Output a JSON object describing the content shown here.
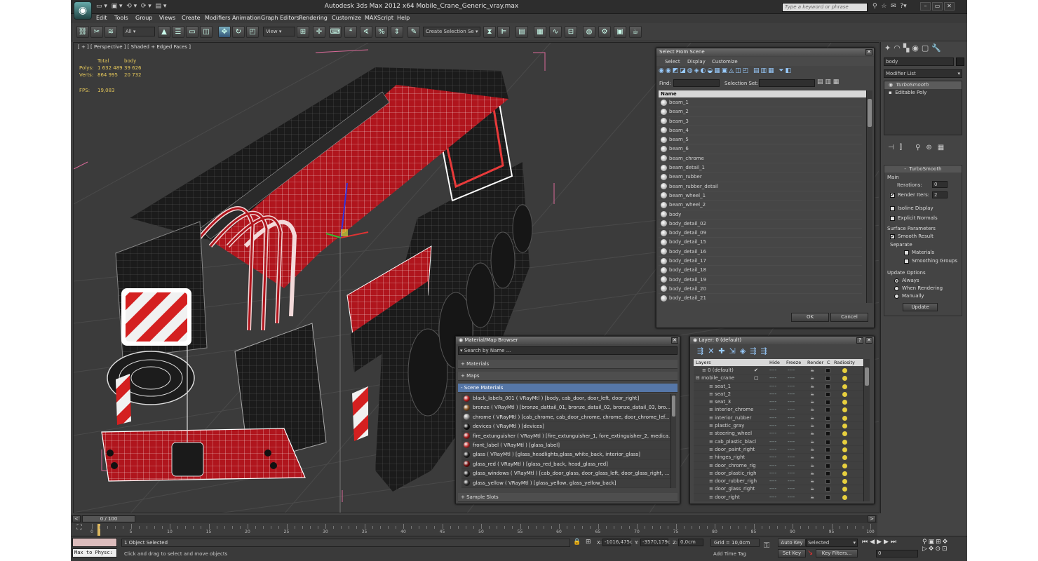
{
  "app": {
    "title": "Autodesk 3ds Max  2012 x64      Mobile_Crane_Generic_vray.max",
    "search_placeholder": "Type a keyword or phrase"
  },
  "menu": [
    "Edit",
    "Tools",
    "Group",
    "Views",
    "Create",
    "Modifiers",
    "Animation",
    "Graph Editors",
    "Rendering",
    "Customize",
    "MAXScript",
    "Help"
  ],
  "toolbar": {
    "filter": "All",
    "refcoord": "View",
    "selset": "Create Selection Se"
  },
  "viewport": {
    "label": "[ + ] [ Perspective ] [ Shaded + Edged Faces ]",
    "stats": {
      "col_total": "Total",
      "col_body": "body",
      "polys_label": "Polys:",
      "polys_total": "1 632 489",
      "polys_body": "39 626",
      "verts_label": "Verts:",
      "verts_total": "864 995",
      "verts_body": "20 732",
      "fps_label": "FPS:",
      "fps": "19,083"
    }
  },
  "select_from_scene": {
    "title": "Select From Scene",
    "tabs": [
      "Select",
      "Display",
      "Customize"
    ],
    "find_label": "Find:",
    "selset_label": "Selection Set:",
    "col_name": "Name",
    "items": [
      "beam_1",
      "beam_2",
      "beam_3",
      "beam_4",
      "beam_5",
      "beam_6",
      "beam_chrome",
      "beam_detail_1",
      "beam_rubber",
      "beam_rubber_detail",
      "beam_wheel_1",
      "beam_wheel_2",
      "body",
      "body_detail_02",
      "body_detail_09",
      "body_detail_15",
      "body_detail_16",
      "body_detail_17",
      "body_detail_18",
      "body_detail_19",
      "body_detail_20",
      "body_detail_21"
    ],
    "ok": "OK",
    "cancel": "Cancel"
  },
  "material_browser": {
    "title": "Material/Map Browser",
    "search_placeholder": "Search by Name ...",
    "cat_materials": "+ Materials",
    "cat_maps": "+ Maps",
    "cat_scene": "- Scene Materials",
    "cat_samples": "+ Sample Slots",
    "items": [
      {
        "text": "black_labels_001  ( VRayMtl )  [body, cab_door, door_left, door_right]",
        "color": "#b22"
      },
      {
        "text": "bronze  ( VRayMtl )  [bronze_dattail_01, bronze_datail_02, bronze_datail_03, bro...",
        "color": "#8a5a2a"
      },
      {
        "text": "chrome  ( VRayMtl )  [cab_chrome, cab_door_chrome, chrome, door_chrome_lef...",
        "color": "#999"
      },
      {
        "text": "devices  ( VRayMtl )  [devices]",
        "color": "#111"
      },
      {
        "text": "fire_extunguisher  ( VRayMtl )  [fire_extunguisher_1, fore_extinguisher_2, medica...",
        "color": "#a22"
      },
      {
        "text": "front_label  ( VRayMtl )  [glass_label]",
        "color": "#b33"
      },
      {
        "text": "glass  ( VRayMtl )  [glass_headlights,glass_white_back, interior_glass]",
        "color": "#222"
      },
      {
        "text": "glass_red  ( VRayMtl )  [glass_red_back, head_glass_red]",
        "color": "#711"
      },
      {
        "text": "glass_windows  ( VRayMtl )  [cab_door_glass, door_glass_left, door_glass_right, ...",
        "color": "#222"
      },
      {
        "text": "glass_yellow  ( VRayMtl )  [glass_yellow, glass_yellow_back]",
        "color": "#333"
      }
    ]
  },
  "layer_manager": {
    "title": "Layer: 0 (default)",
    "cols": [
      "Layers",
      "Hide",
      "Freeze",
      "Render",
      "C",
      "Radiosity"
    ],
    "rows": [
      {
        "name": "0 (default)",
        "indent": 1,
        "mark": "✔"
      },
      {
        "name": "mobile_crane",
        "indent": 0,
        "mark": "▢"
      },
      {
        "name": "seat_1",
        "indent": 2
      },
      {
        "name": "seat_2",
        "indent": 2
      },
      {
        "name": "seat_3",
        "indent": 2
      },
      {
        "name": "interior_chrome",
        "indent": 2
      },
      {
        "name": "interior_rubber",
        "indent": 2
      },
      {
        "name": "plastic_gray",
        "indent": 2
      },
      {
        "name": "steering_wheel",
        "indent": 2
      },
      {
        "name": "cab_plastic_blacl",
        "indent": 2
      },
      {
        "name": "door_paint_right",
        "indent": 2
      },
      {
        "name": "hinges_right",
        "indent": 2
      },
      {
        "name": "door_chrome_rig",
        "indent": 2
      },
      {
        "name": "door_plastic_righ",
        "indent": 2
      },
      {
        "name": "door_rubber_righ",
        "indent": 2
      },
      {
        "name": "door_glass_right",
        "indent": 2
      },
      {
        "name": "door_right",
        "indent": 2
      }
    ]
  },
  "command_panel": {
    "object_name": "body",
    "modifier_list": "Modifier List",
    "stack": [
      "TurboSmooth",
      "Editable Poly"
    ],
    "rollout_title": "TurboSmooth",
    "main_label": "Main",
    "iterations_label": "Iterations:",
    "iterations": "0",
    "render_iters_label": "Render Iters:",
    "render_iters": "2",
    "isoline": "Isoline Display",
    "explicit": "Explicit Normals",
    "surface_params": "Surface Parameters",
    "smooth_result": "Smooth Result",
    "separate": "Separate",
    "materials": "Materials",
    "smoothing_groups": "Smoothing Groups",
    "update_options": "Update Options",
    "always": "Always",
    "when_rendering": "When Rendering",
    "manually": "Manually",
    "update_btn": "Update"
  },
  "timeline": {
    "frame": "0 / 100",
    "ticks": [
      "0",
      "5",
      "10",
      "15",
      "20",
      "25",
      "30",
      "35",
      "40",
      "45",
      "50",
      "55",
      "60",
      "65",
      "70",
      "75",
      "80",
      "85",
      "90",
      "95",
      "100"
    ]
  },
  "status": {
    "maxscript": "Max to Physc:",
    "selected": "1 Object Selected",
    "prompt": "Click and drag to select and move objects",
    "x_label": "X:",
    "x": "-1016,475c",
    "y_label": "Y:",
    "y": "-3570,179c",
    "z_label": "Z:",
    "z": "0,0cm",
    "grid": "Grid = 10,0cm",
    "add_time_tag": "Add Time Tag",
    "auto_key": "Auto Key",
    "set_key": "Set Key",
    "key_mode": "Selected",
    "key_filters": "Key Filters...",
    "frame_field": "0"
  }
}
